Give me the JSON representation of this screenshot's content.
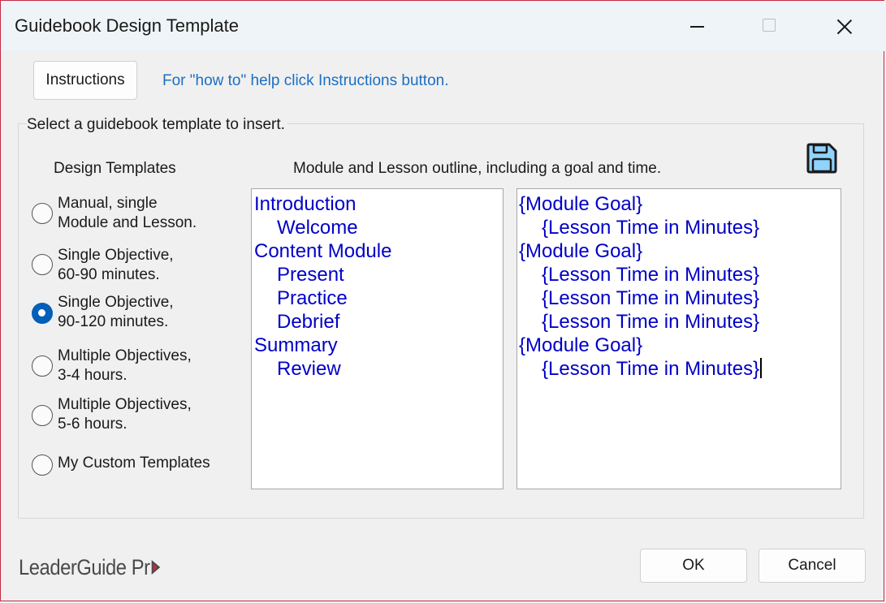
{
  "window": {
    "title": "Guidebook Design Template"
  },
  "header": {
    "instructions_label": "Instructions",
    "help_text": "For \"how to\" help click Instructions button."
  },
  "group": {
    "label": "Select a guidebook template to insert."
  },
  "design_templates": {
    "heading": "Design Templates",
    "options": [
      {
        "line1": "Manual, single",
        "line2": "Module and Lesson.",
        "checked": false
      },
      {
        "line1": "Single Objective,",
        "line2": "60-90 minutes.",
        "checked": false
      },
      {
        "line1": "Single Objective,",
        "line2": "90-120 minutes.",
        "checked": true
      },
      {
        "line1": "Multiple Objectives,",
        "line2": "3-4 hours.",
        "checked": false
      },
      {
        "line1": "Multiple Objectives,",
        "line2": "5-6 hours.",
        "checked": false
      },
      {
        "line1": "My Custom Templates",
        "line2": "",
        "checked": false
      }
    ]
  },
  "outline": {
    "heading": "Module and Lesson outline, including a goal and time.",
    "lines": [
      "Introduction",
      "Welcome",
      "Content Module",
      "Present",
      "Practice",
      "Debrief",
      "Summary",
      "Review"
    ],
    "goals": [
      "{Module Goal}",
      "{Lesson Time in Minutes}",
      "{Module Goal}",
      "{Lesson Time in Minutes}",
      "{Lesson Time in Minutes}",
      "{Lesson Time in Minutes}",
      "{Module Goal}",
      "{Lesson Time in Minutes}"
    ],
    "text_color": "#0000c8"
  },
  "footer": {
    "logo_text": "LeaderGuide Pr",
    "ok_label": "OK",
    "cancel_label": "Cancel"
  },
  "icons": {
    "save": "floppy-disk-icon",
    "accent": "#c42b43"
  }
}
